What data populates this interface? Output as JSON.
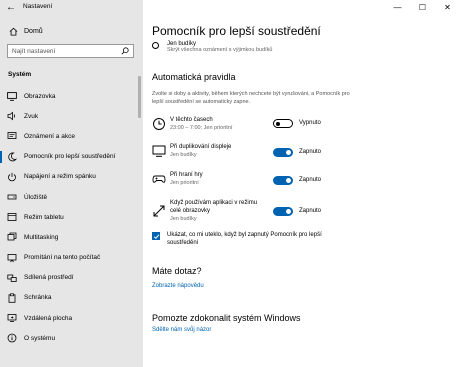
{
  "window": {
    "title": "Nastavení",
    "back": "←",
    "minimize": "—",
    "maximize": "☐",
    "close": "✕"
  },
  "sidebar": {
    "home_label": "Domů",
    "search_placeholder": "Najít nastavení",
    "section": "Systém",
    "items": [
      {
        "label": "Obrazovka",
        "icon": "monitor-icon"
      },
      {
        "label": "Zvuk",
        "icon": "speaker-icon"
      },
      {
        "label": "Oznámení a akce",
        "icon": "notification-icon"
      },
      {
        "label": "Pomocník pro lepší soustředění",
        "icon": "moon-icon",
        "active": true
      },
      {
        "label": "Napájení a režim spánku",
        "icon": "power-icon"
      },
      {
        "label": "Úložiště",
        "icon": "storage-icon"
      },
      {
        "label": "Režim tabletu",
        "icon": "tablet-icon"
      },
      {
        "label": "Multitasking",
        "icon": "multitasking-icon"
      },
      {
        "label": "Promítání na tento počítač",
        "icon": "projecting-icon"
      },
      {
        "label": "Sdílená prostředí",
        "icon": "shared-experiences-icon"
      },
      {
        "label": "Schránka",
        "icon": "clipboard-icon"
      },
      {
        "label": "Vzdálená plocha",
        "icon": "remote-desktop-icon"
      },
      {
        "label": "O systému",
        "icon": "info-icon"
      }
    ]
  },
  "main": {
    "title": "Pomocník pro lepší soustředění",
    "alarms_only": {
      "label": "Jen budíky",
      "desc": "Skrýt všechna oznámení s výjimkou budíků"
    },
    "rules_heading": "Automatická pravidla",
    "rules_desc": "Zvolte si doby a aktivity, během kterých nechcete být vyrušováni, a Pomocník pro lepší soustředění se automaticky zapne.",
    "rules": [
      {
        "name": "V těchto časech",
        "sub": "23:00 – 7:00; Jen prioritní",
        "state": "Vypnuto",
        "on": false,
        "icon": "clock-icon"
      },
      {
        "name": "Při duplikování displeje",
        "sub": "Jen budíky",
        "state": "Zapnuto",
        "on": true,
        "icon": "display-icon"
      },
      {
        "name": "Při hraní hry",
        "sub": "Jen prioritní",
        "state": "Zapnuto",
        "on": true,
        "icon": "gamepad-icon"
      },
      {
        "name": "Když používám aplikaci v režimu celé obrazovky",
        "sub": "Jen budíky",
        "state": "Zapnuto",
        "on": true,
        "icon": "fullscreen-icon"
      }
    ],
    "checkbox_label": "Ukázat, co mi uteklo, když byl zapnutý Pomocník pro lepší soustředění",
    "question_heading": "Máte dotaz?",
    "help_link": "Zobrazte nápovědu",
    "improve_heading": "Pomozte zdokonalit systém Windows",
    "feedback_link": "Sdělte nám svůj názor"
  },
  "colors": {
    "accent": "#0063b1",
    "sidebar_bg": "#e6e6e6"
  }
}
